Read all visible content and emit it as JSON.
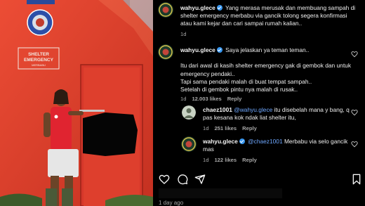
{
  "photo": {
    "sign_title": "SHELTER\nEMERGENCY",
    "sign_sub": "MERBABU"
  },
  "comments": [
    {
      "user": "wahyu.glece",
      "verified": true,
      "text": "Yang merasa merusak dan membuang sampah di shelter emergency merbabu via gancik tolong segera konfirmasi atau kami kejar dan cari sampai rumah kalian..",
      "time": "1d",
      "likes": "",
      "reply_label": ""
    },
    {
      "user": "wahyu.glece",
      "verified": true,
      "text": "Saya jelaskan ya teman teman..\n\nItu dari awal di kasih shelter emergency gak di gembok dan untuk emergency pendaki..\nTapi sama pendaki malah di buat tempat sampah..\nSetelah di gembok pintu nya malah di rusak..",
      "time": "1d",
      "likes": "12.003 likes",
      "reply_label": "Reply"
    },
    {
      "user": "chaez1001",
      "verified": false,
      "mention": "@wahyu.glece",
      "text": "itu disebelah mana y bang, q pas kesana kok ndak liat shelter itu,",
      "time": "1d",
      "likes": "251 likes",
      "reply_label": "Reply"
    },
    {
      "user": "wahyu.glece",
      "verified": true,
      "mention": "@chaez1001",
      "text": "Merbabu via selo gancik mas",
      "time": "1d",
      "likes": "122 likes",
      "reply_label": "Reply"
    }
  ],
  "footer": {
    "date": "1 day ago"
  },
  "icons": {
    "like": "heart-icon",
    "comment": "comment-icon",
    "share": "send-icon",
    "save": "bookmark-icon"
  },
  "colors": {
    "shelter": "#e8402a",
    "mention": "#6fa8ff",
    "verified": "#3897f0"
  }
}
